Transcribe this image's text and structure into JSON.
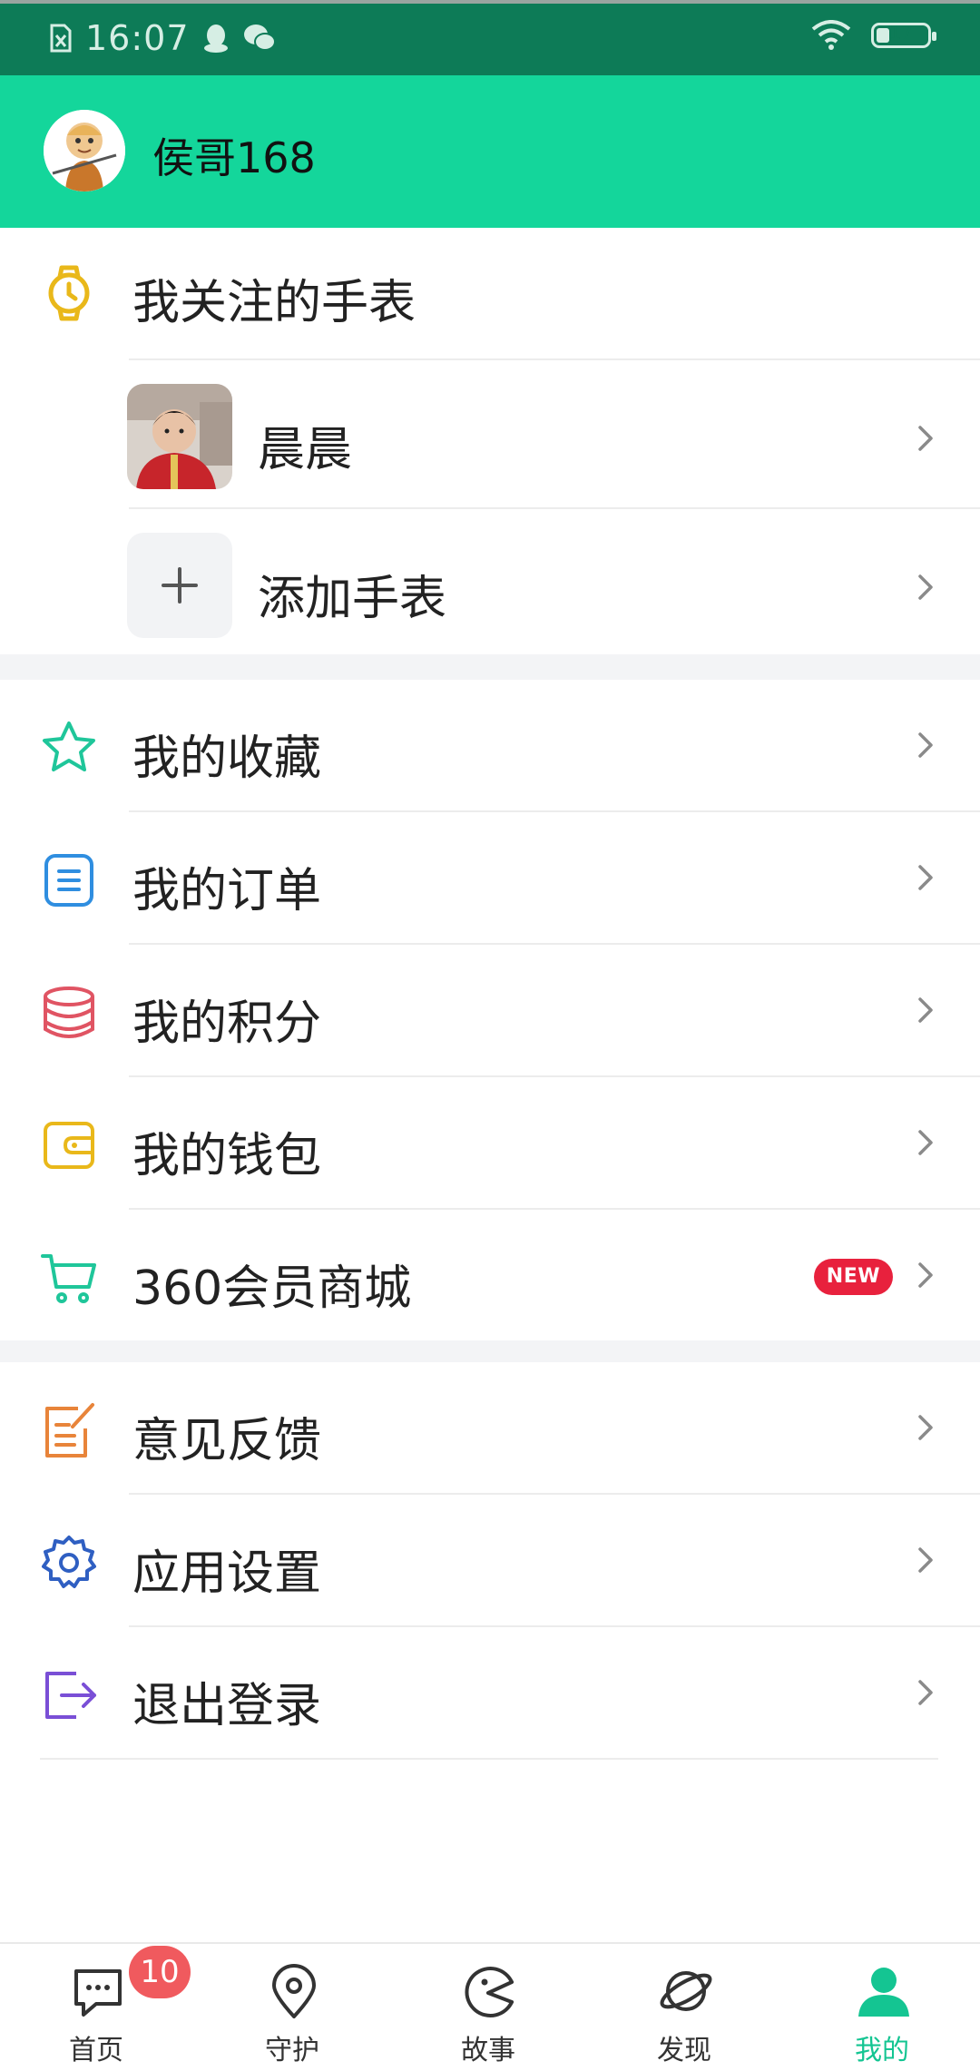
{
  "status": {
    "time": "16:07",
    "battery_percent": "17"
  },
  "profile": {
    "username": "侯哥168"
  },
  "watch_section": {
    "title": "我关注的手表",
    "child_name": "晨晨",
    "add_label": "添加手表"
  },
  "menu1": [
    {
      "label": "我的收藏"
    },
    {
      "label": "我的订单"
    },
    {
      "label": "我的积分"
    },
    {
      "label": "我的钱包"
    },
    {
      "label": "360会员商城",
      "badge": "NEW"
    }
  ],
  "menu2": [
    {
      "label": "意见反馈"
    },
    {
      "label": "应用设置"
    },
    {
      "label": "退出登录"
    }
  ],
  "tabs": [
    {
      "label": "首页",
      "badge": "10"
    },
    {
      "label": "守护"
    },
    {
      "label": "故事"
    },
    {
      "label": "发现"
    },
    {
      "label": "我的"
    }
  ],
  "colors": {
    "statusbar": "#0d7b57",
    "header": "#14d69b",
    "accent": "#14c592",
    "new_badge": "#e8213d",
    "tab_badge": "#f05a5e"
  }
}
